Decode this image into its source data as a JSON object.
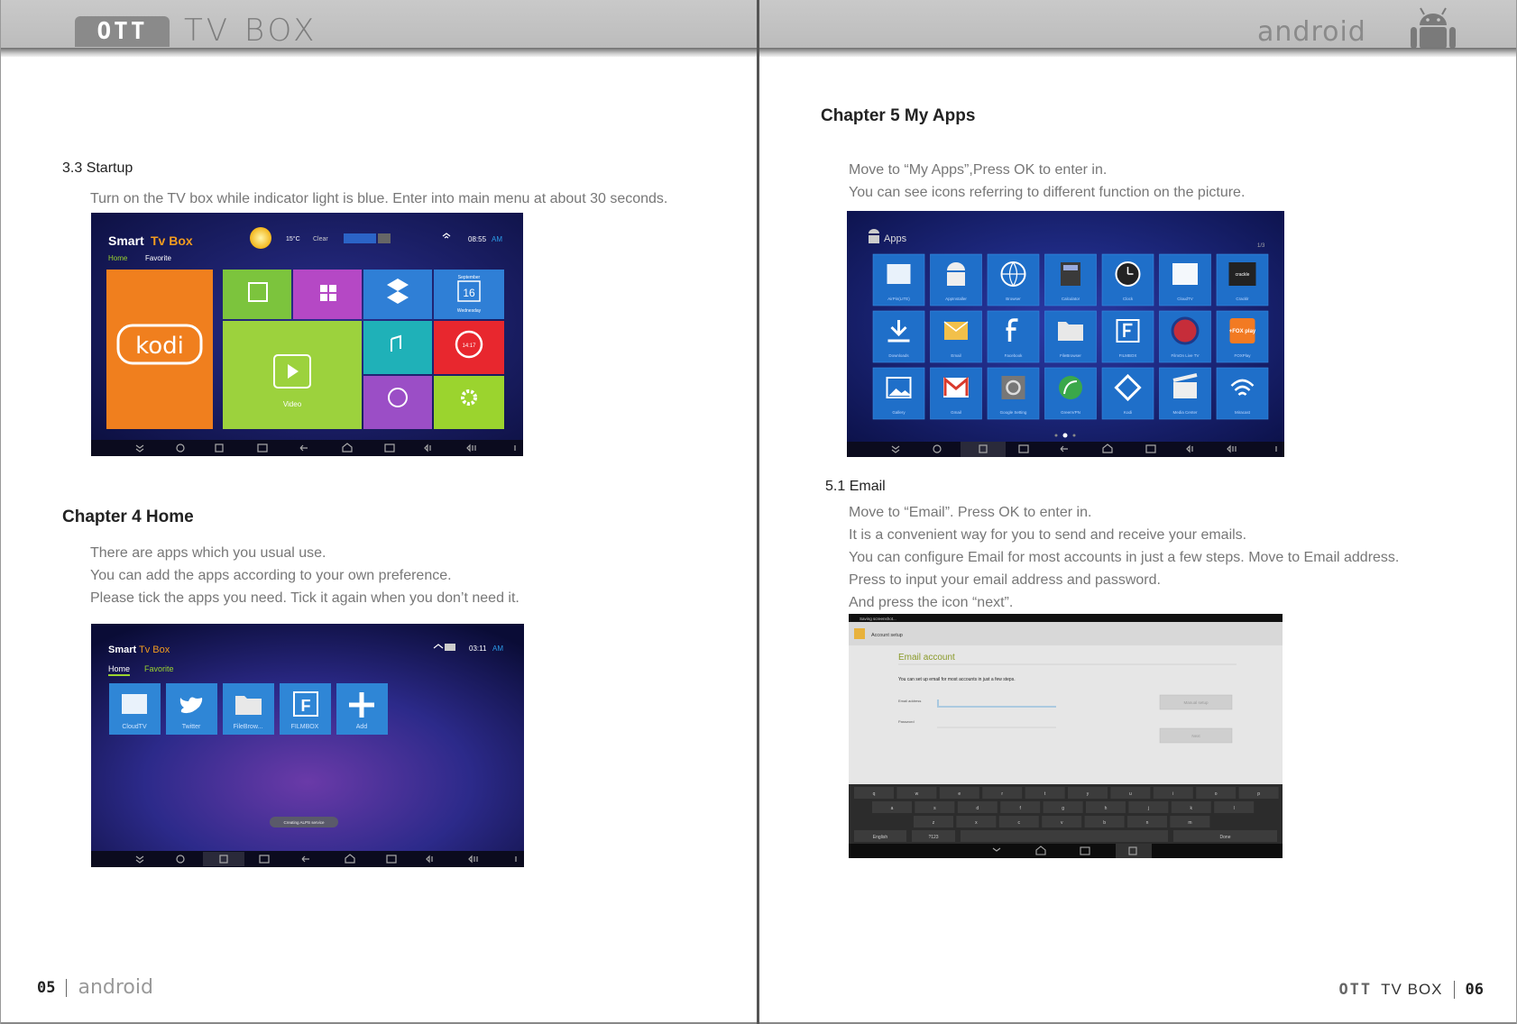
{
  "header": {
    "ott_badge": "OTT",
    "tv_box": "TV BOX",
    "android_word": "android"
  },
  "left_page": {
    "section_3_3": {
      "heading": "3.3 Startup",
      "lines": [
        "Turn on the TV box while indicator light is blue. Enter into main menu at about 30 seconds."
      ]
    },
    "startup_screen": {
      "brand_smart": "Smart",
      "brand_tvbox": "Tv Box",
      "nav_home": "Home",
      "nav_favorite": "Favorite",
      "temperature": "15°C",
      "weather": "Clear",
      "time": "08:55",
      "ampm": "AM",
      "kodi_label": "kodi",
      "calendar_month": "September",
      "calendar_day": "16",
      "calendar_weekday": "Wednesday",
      "video_label": "Video",
      "clock_tile_time": "14:17",
      "colors": {
        "kodi_tile": "#f07f1e",
        "green_tile": "#7cc43d",
        "purple_tile": "#b548c5",
        "blue_tile": "#2f7fd6",
        "teal_tile": "#1fb1b8",
        "red_tile": "#e8272e",
        "lime_tile": "#9bd42e"
      }
    },
    "chapter_4": {
      "heading": "Chapter 4 Home",
      "lines": [
        "There are apps which you usual use.",
        "You can add the apps according to your own preference.",
        "Please tick the apps you need. Tick it again when you don’t need it."
      ]
    },
    "home_screen": {
      "brand_smart": "Smart",
      "brand_tvbox": "Tv Box",
      "nav_home": "Home",
      "nav_favorite": "Favorite",
      "time": "03:11",
      "ampm": "AM",
      "apps": [
        {
          "label": "CloudTV",
          "icon": "cloud-icon"
        },
        {
          "label": "Twitter",
          "icon": "twitter-bird-icon"
        },
        {
          "label": "FileBrow...",
          "icon": "folder-icon"
        },
        {
          "label": "FILMBOX",
          "icon": "filmbox-f-icon"
        },
        {
          "label": "Add",
          "icon": "plus-icon"
        }
      ],
      "toast": "Creating ALPS service"
    },
    "page_number": "05",
    "footer_android": "android"
  },
  "right_page": {
    "chapter_5": {
      "heading": "Chapter 5 My Apps",
      "lines": [
        "Move to “My Apps”,Press OK to enter in.",
        "You can see icons referring to different function on the picture."
      ]
    },
    "apps_screen": {
      "title": "Apps",
      "rows": [
        [
          {
            "label": "AirPin(LITE)",
            "icon": "airpin-icon"
          },
          {
            "label": "AppInstaller",
            "icon": "android-installer-icon"
          },
          {
            "label": "Browser",
            "icon": "globe-icon"
          },
          {
            "label": "Calculator",
            "icon": "calculator-icon"
          },
          {
            "label": "Clock",
            "icon": "clock-icon"
          },
          {
            "label": "CloudTV",
            "icon": "cloud-icon"
          },
          {
            "label": "Cracklr",
            "icon": "crackle-icon"
          }
        ],
        [
          {
            "label": "Downloads",
            "icon": "download-icon"
          },
          {
            "label": "Email",
            "icon": "email-icon"
          },
          {
            "label": "Facebook",
            "icon": "facebook-icon"
          },
          {
            "label": "FileBrowser",
            "icon": "folder-icon"
          },
          {
            "label": "FILMBOX",
            "icon": "filmbox-f-icon"
          },
          {
            "label": "FilmOn Live TV",
            "icon": "filmon-icon"
          },
          {
            "label": "FOXPlay",
            "icon": "foxplay-icon"
          }
        ],
        [
          {
            "label": "Gallery",
            "icon": "gallery-icon"
          },
          {
            "label": "Gmail",
            "icon": "gmail-icon"
          },
          {
            "label": "Google Setting",
            "icon": "google-settings-icon"
          },
          {
            "label": "GreenVPN",
            "icon": "vpn-leaf-icon"
          },
          {
            "label": "Kodi",
            "icon": "kodi-icon"
          },
          {
            "label": "Media Center",
            "icon": "clapper-icon"
          },
          {
            "label": "Miracast",
            "icon": "wifi-cast-icon"
          }
        ]
      ],
      "fox_text": "+FOX play",
      "crackle_text": "crackle"
    },
    "section_5_1": {
      "heading": "5.1 Email",
      "lines": [
        "Move to “Email”. Press OK to enter in.",
        "It is a convenient way for you to send and receive your emails.",
        "You can configure Email for most accounts in just a few steps. Move to Email address.",
        "Press to input your email address and password.",
        "And press the icon “next”."
      ]
    },
    "email_screen": {
      "status": "Saving screenshot...",
      "appbar_title": "Account setup",
      "heading": "Email account",
      "subtitle": "You can set up email for most accounts in just a few steps.",
      "email_label": "Email address",
      "password_label": "Password",
      "manual_button": "Manual setup",
      "next_button": "Next",
      "keys_row1": [
        "q",
        "w",
        "e",
        "r",
        "t",
        "y",
        "u",
        "i",
        "o",
        "p"
      ],
      "keys_row2": [
        "a",
        "s",
        "d",
        "f",
        "g",
        "h",
        "j",
        "k",
        "l"
      ],
      "keys_row3": [
        "z",
        "x",
        "c",
        "v",
        "b",
        "n",
        "m"
      ],
      "key_english": "English",
      "key_123": "?123",
      "key_done": "Done"
    },
    "footer_ott": "OTT",
    "footer_tvbox": "TV BOX",
    "page_number": "06"
  }
}
